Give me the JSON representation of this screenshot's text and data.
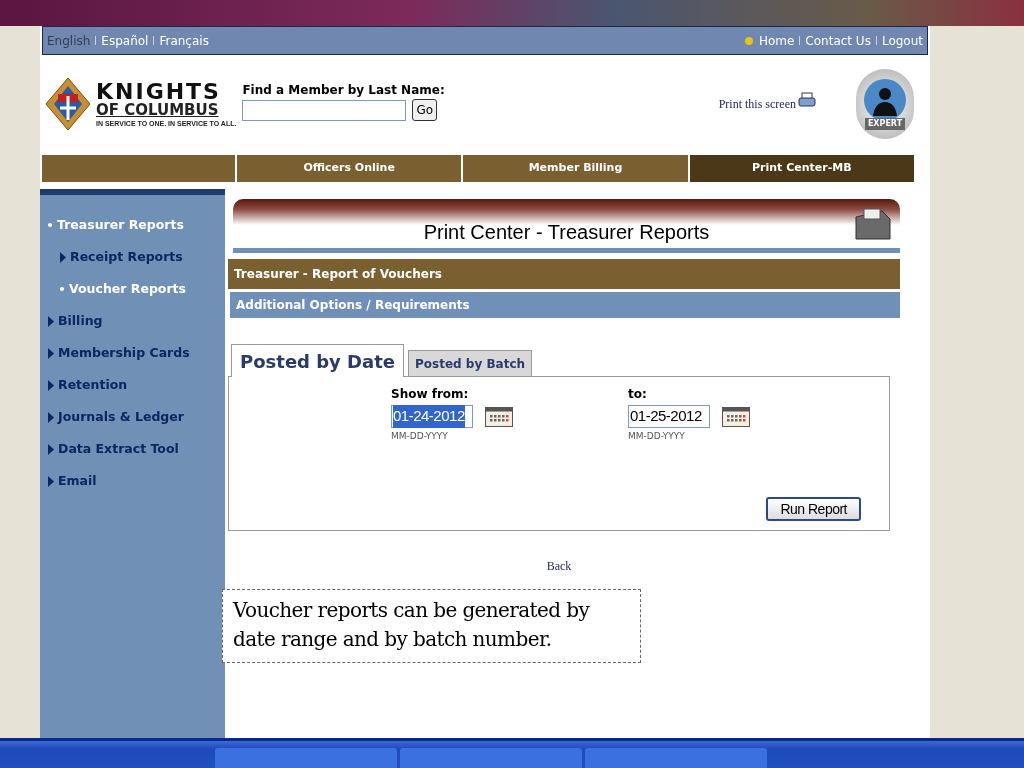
{
  "languages": [
    {
      "label": "English",
      "selected": true
    },
    {
      "label": "Español",
      "selected": false
    },
    {
      "label": "Français",
      "selected": false
    }
  ],
  "top_links": [
    "Home",
    "Contact Us",
    "Logout"
  ],
  "logo": {
    "title": "KNIGHTS",
    "subtitle": "OF COLUMBUS",
    "tagline": "IN SERVICE TO ONE. IN SERVICE TO ALL."
  },
  "search": {
    "label": "Find a Member by Last Name:",
    "button": "Go"
  },
  "print_link": "Print this screen",
  "badge": "EXPERT",
  "nav": [
    {
      "label": "Officers Online",
      "selected": false
    },
    {
      "label": "Member Billing",
      "selected": false
    },
    {
      "label": "Print Center-MB",
      "selected": true
    }
  ],
  "sidebar": [
    {
      "label": "Treasurer Reports",
      "kind": "bullet",
      "children": [
        {
          "label": "Receipt Reports",
          "kind": "arrow"
        },
        {
          "label": "Voucher Reports",
          "kind": "bullet"
        }
      ]
    },
    {
      "label": "Billing",
      "kind": "arrow"
    },
    {
      "label": "Membership Cards",
      "kind": "arrow"
    },
    {
      "label": "Retention",
      "kind": "arrow"
    },
    {
      "label": "Journals & Ledger",
      "kind": "arrow"
    },
    {
      "label": "Data Extract Tool",
      "kind": "arrow"
    },
    {
      "label": "Email",
      "kind": "arrow"
    }
  ],
  "page_title": "Print Center - Treasurer Reports",
  "section_title": "Treasurer - Report of Vouchers",
  "subsection_title": "Additional Options / Requirements",
  "tabs": [
    {
      "label": "Posted by Date",
      "selected": true
    },
    {
      "label": "Posted by Batch",
      "selected": false
    }
  ],
  "fields": [
    {
      "label": "Show from:",
      "value": "01-24-2012",
      "hint": "MM-DD-YYYY",
      "highlighted": true
    },
    {
      "label": "to:",
      "value": "01-25-2012",
      "hint": "MM-DD-YYYY",
      "highlighted": false
    }
  ],
  "run_button": "Run Report",
  "back_link": "Back",
  "callout": "Voucher reports can be generated by date range and by batch number."
}
